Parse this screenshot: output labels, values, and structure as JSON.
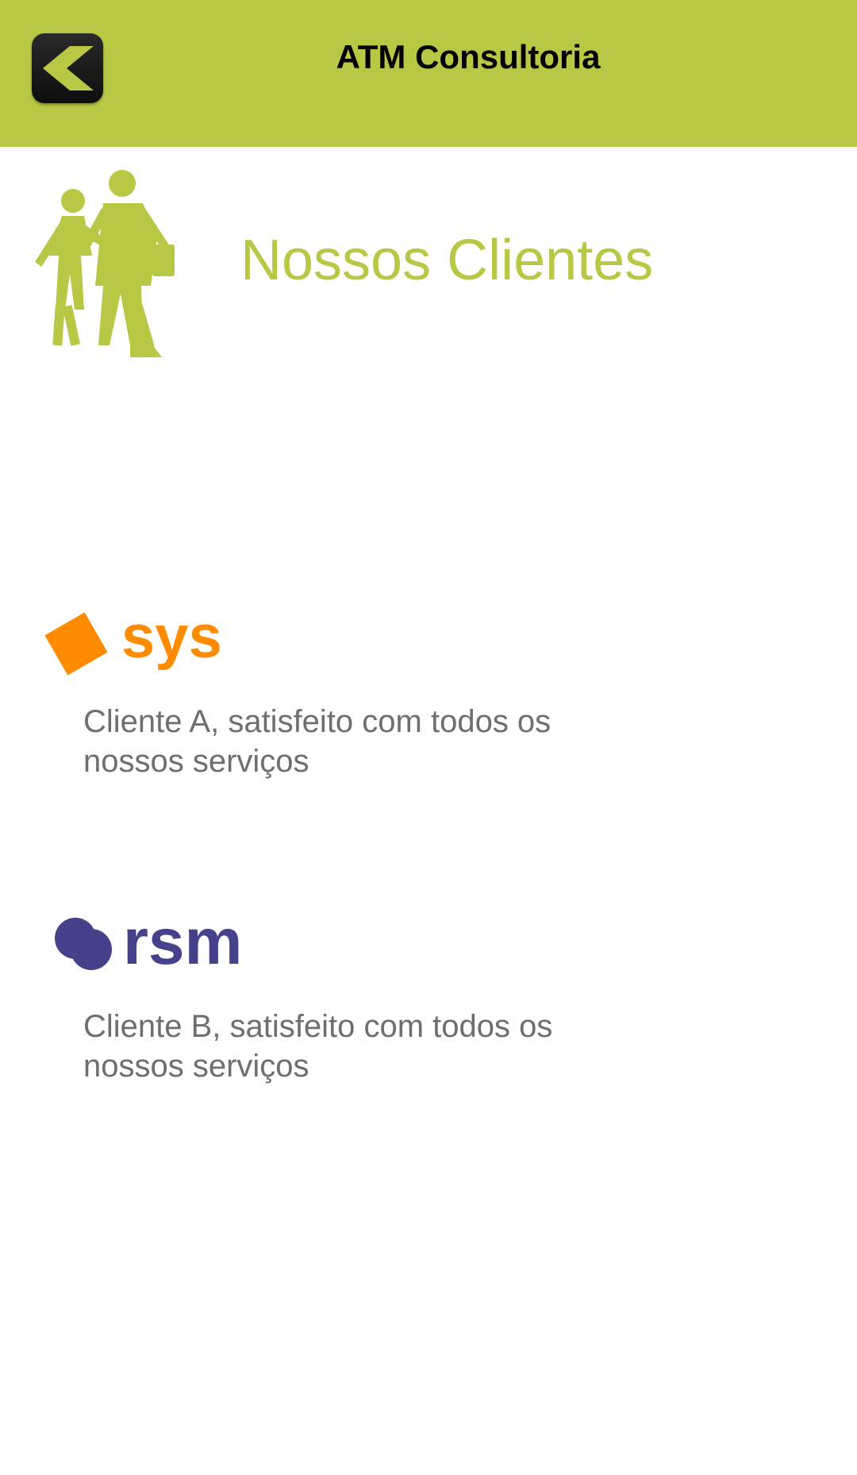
{
  "app_bar": {
    "title": "ATM Consultoria",
    "back_icon": "back-arrow-icon",
    "color": "#b9c844"
  },
  "section": {
    "title": "Nossos Clientes",
    "icon": "people-walking-icon",
    "accent_color": "#b9c844"
  },
  "clients": [
    {
      "logo_text": "sys",
      "logo_color": "#ff8c00",
      "description": "Cliente A, satisfeito com todos os nossos serviços"
    },
    {
      "logo_text": "rsm",
      "logo_color": "#45418a",
      "description": "Cliente B, satisfeito com todos os nossos serviços"
    }
  ]
}
